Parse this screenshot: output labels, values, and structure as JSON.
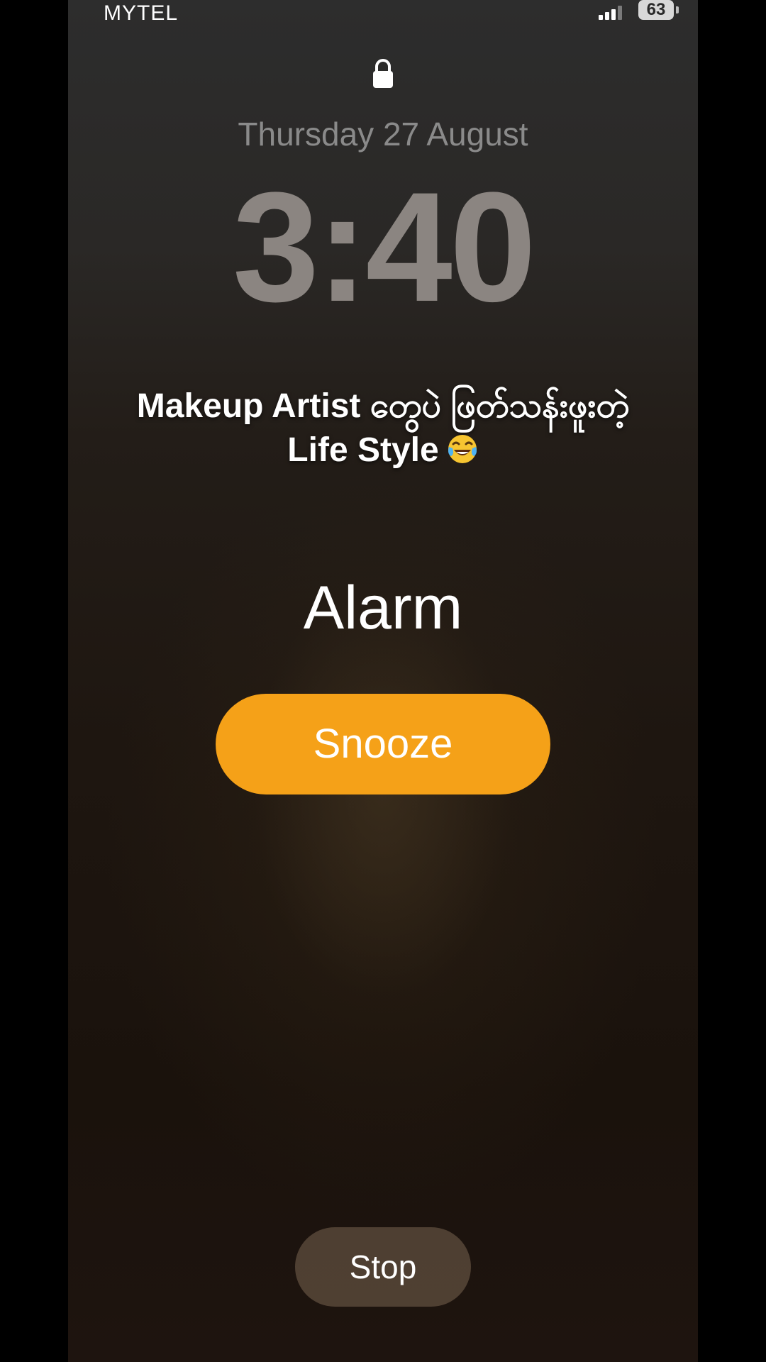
{
  "status_bar": {
    "carrier": "MYTEL",
    "battery_percent": "63",
    "signal_bars_active": 3,
    "signal_bars_total": 4
  },
  "lock_screen": {
    "lock_icon": "lock-icon",
    "date": "Thursday 27 August",
    "time": "3:40"
  },
  "caption": {
    "line1": "Makeup Artist တွေပဲ ဖြတ်သန်းဖူးတဲ့",
    "line2": "Life Style",
    "emoji_icon": "tears-of-joy-emoji-icon"
  },
  "alarm": {
    "label": "Alarm",
    "snooze_label": "Snooze",
    "stop_label": "Stop"
  },
  "colors": {
    "snooze_accent": "#f5a118",
    "background_top": "#2d2d2d",
    "background_bottom": "#1a120c"
  }
}
